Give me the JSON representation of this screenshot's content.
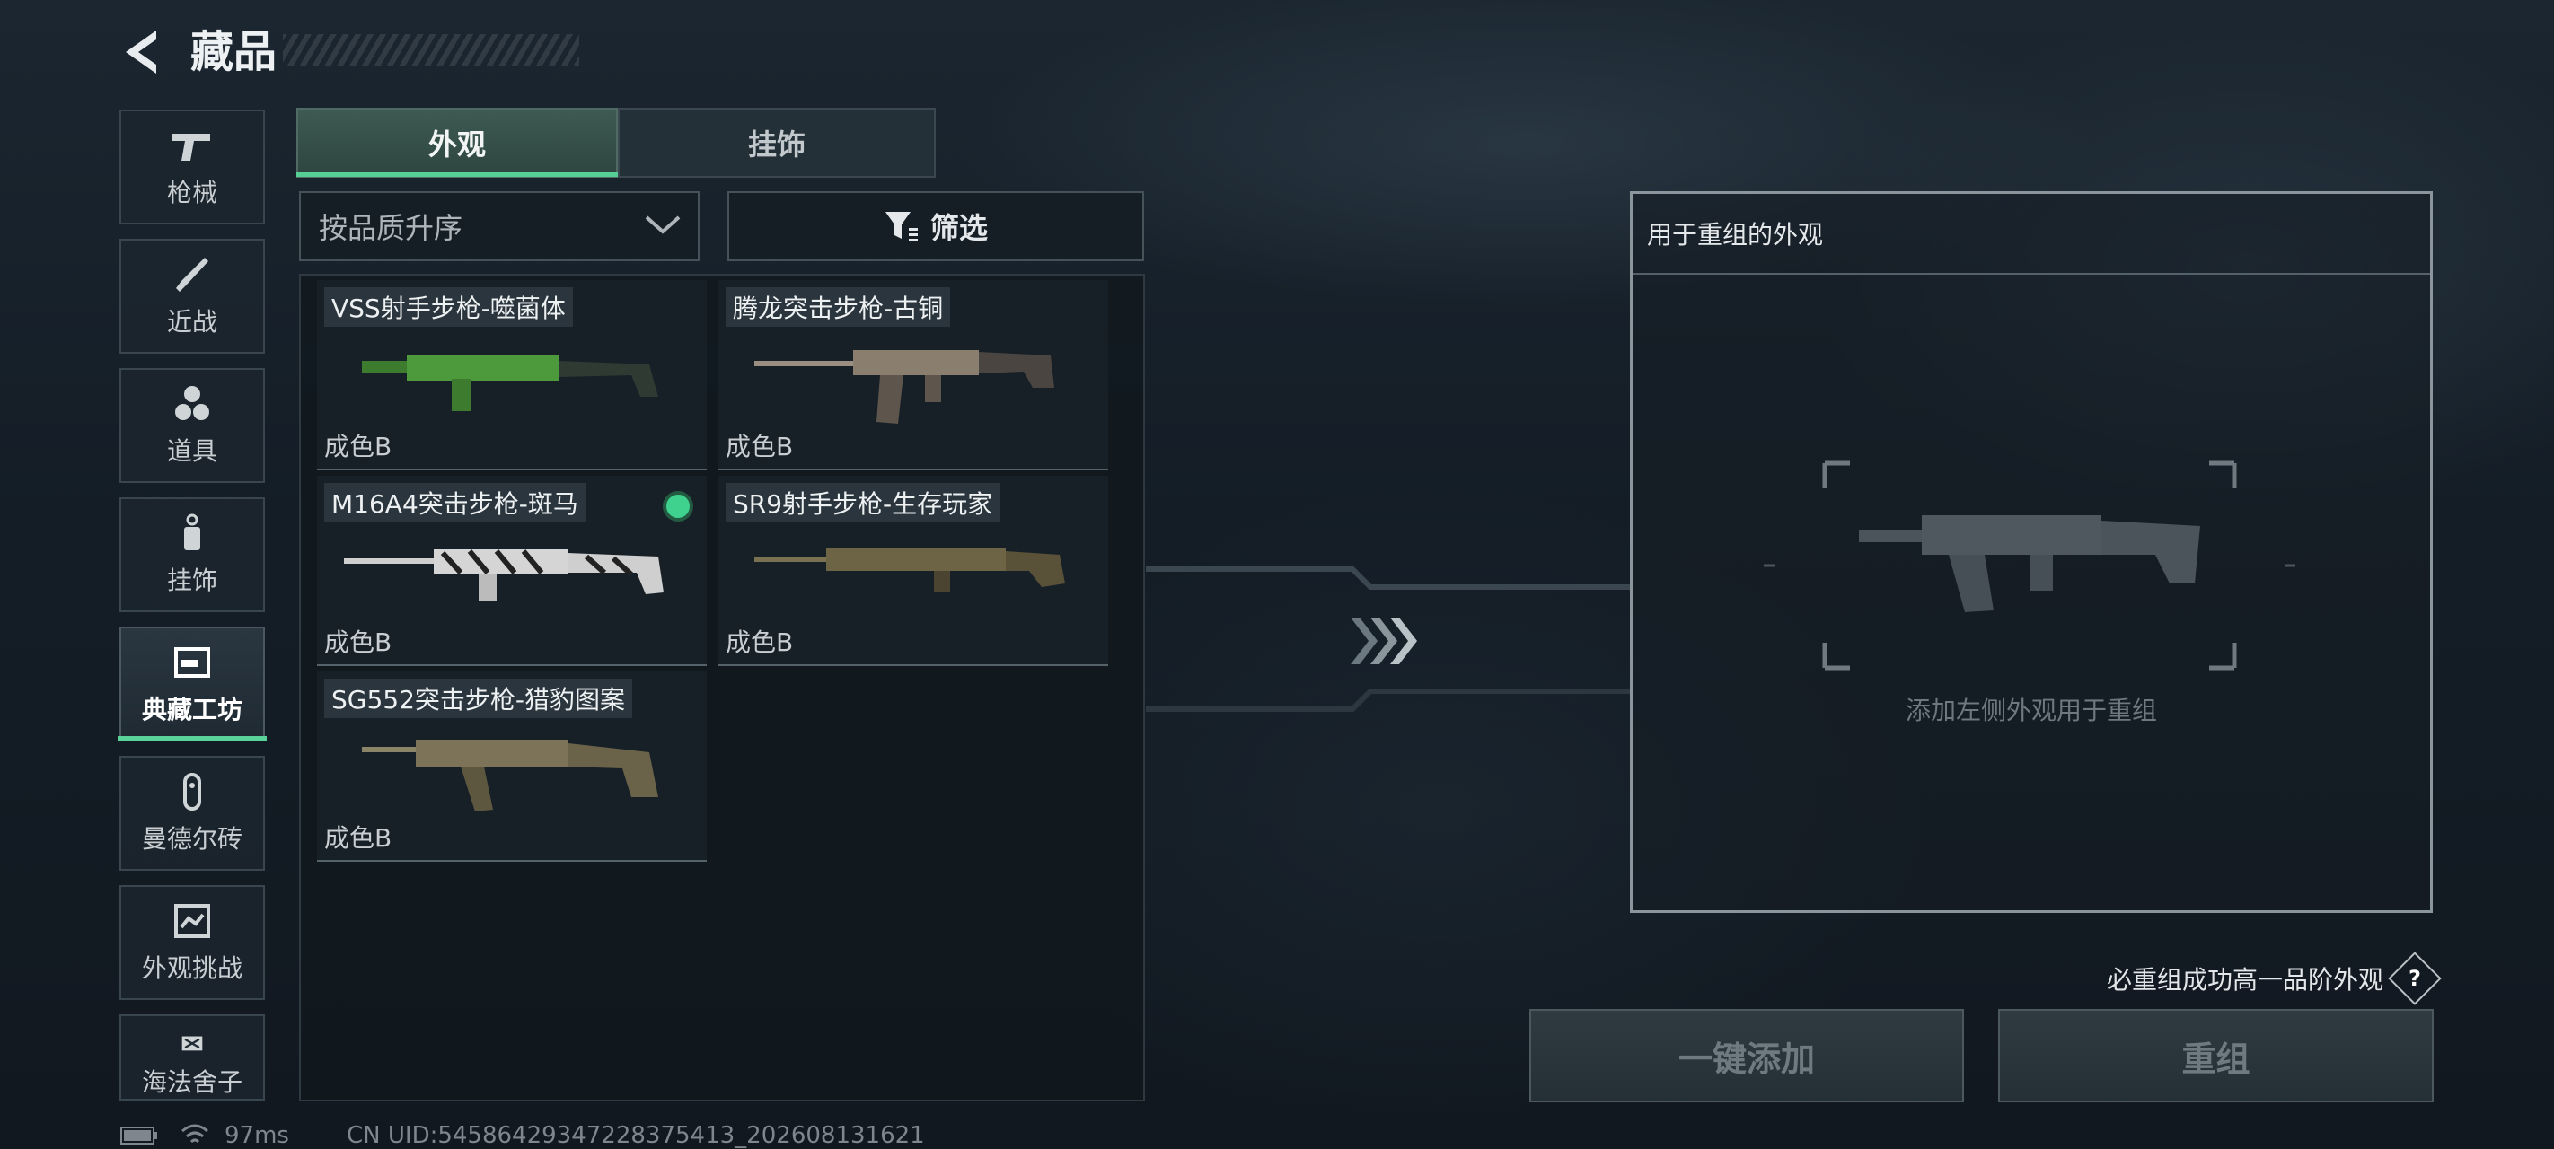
{
  "header": {
    "title": "藏品"
  },
  "sidebar": {
    "items": [
      {
        "label": "枪械",
        "icon": "pistol-icon"
      },
      {
        "label": "近战",
        "icon": "knife-icon"
      },
      {
        "label": "道具",
        "icon": "grenade-icon"
      },
      {
        "label": "挂饰",
        "icon": "charm-icon"
      },
      {
        "label": "典藏工坊",
        "icon": "workshop-icon",
        "active": true
      },
      {
        "label": "曼德尔砖",
        "icon": "brick-icon"
      },
      {
        "label": "外观挑战",
        "icon": "challenge-icon"
      },
      {
        "label": "海法舍子",
        "icon": "partial-icon"
      }
    ]
  },
  "tabs": [
    {
      "label": "外观",
      "selected": true
    },
    {
      "label": "挂饰",
      "selected": false
    }
  ],
  "sort": {
    "value": "按品质升序"
  },
  "filter": {
    "label": "筛选"
  },
  "items": [
    {
      "name": "VSS射手步枪-噬菌体",
      "grade": "成色B",
      "equipped": false,
      "color": "#4d9a3c"
    },
    {
      "name": "腾龙突击步枪-古铜",
      "grade": "成色B",
      "equipped": false,
      "color": "#8a7e6e"
    },
    {
      "name": "M16A4突击步枪-斑马",
      "grade": "成色B",
      "equipped": true,
      "color": "#d5d5d5"
    },
    {
      "name": "SR9射手步枪-生存玩家",
      "grade": "成色B",
      "equipped": false,
      "color": "#6d6446"
    },
    {
      "name": "SG552突击步枪-猎豹图案",
      "grade": "成色B",
      "equipped": false,
      "color": "#7c7358"
    }
  ],
  "recompose": {
    "header": "用于重组的外观",
    "placeholder": "添加左侧外观用于重组",
    "note": "必重组成功高一品阶外观",
    "help": "?",
    "add_button": "一键添加",
    "recompose_button": "重组"
  },
  "footer": {
    "ping": "97ms",
    "uid": "CN UID:54586429347228375413_202608131621"
  },
  "colors": {
    "accent": "#55cf95"
  }
}
